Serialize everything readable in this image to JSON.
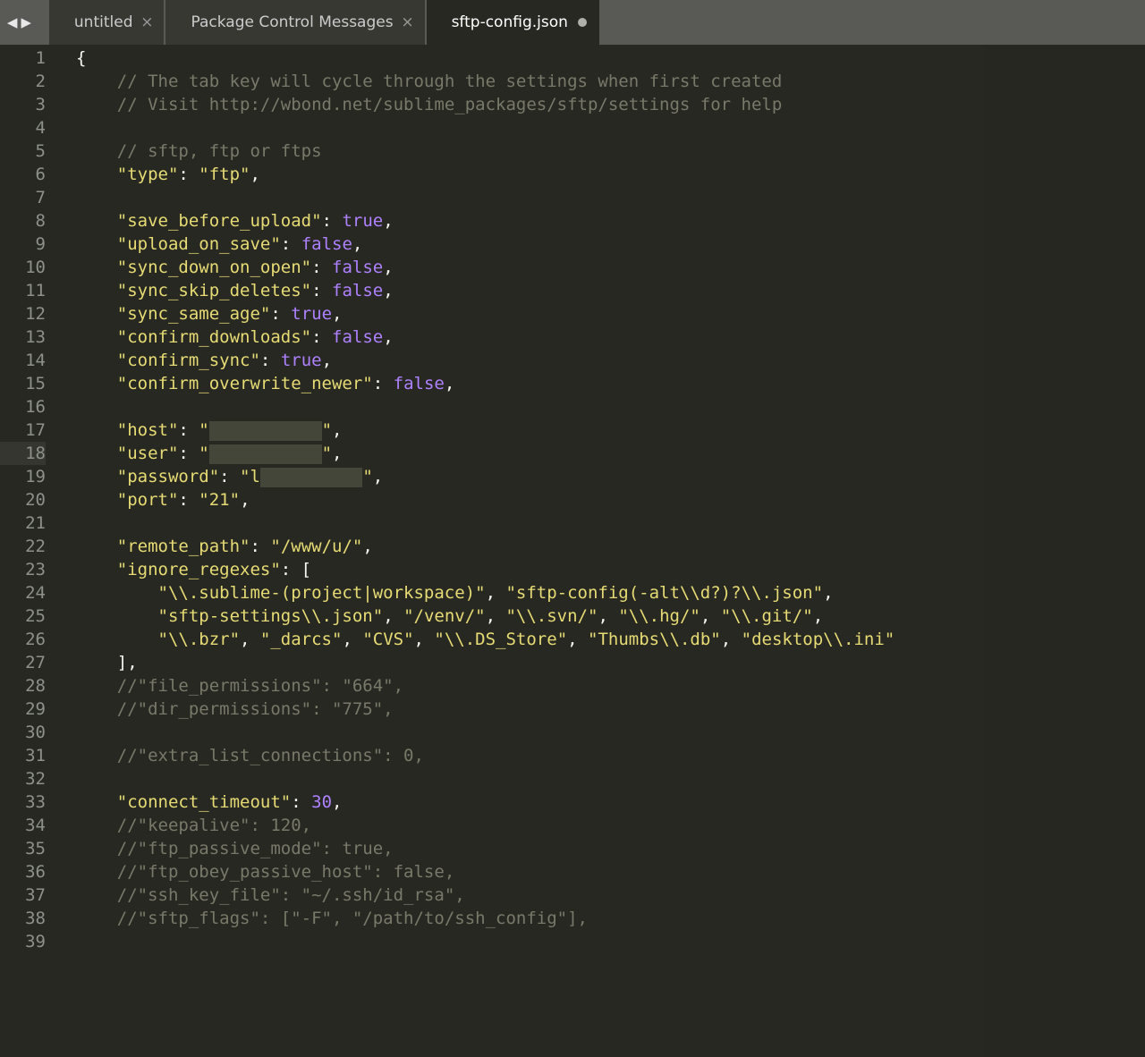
{
  "tabs": [
    {
      "label": "untitled",
      "dirty": false
    },
    {
      "label": "Package Control Messages",
      "dirty": false
    },
    {
      "label": "sftp-config.json",
      "dirty": true
    }
  ],
  "active_tab_index": 2,
  "code_lines": [
    {
      "num": 1,
      "modified": false,
      "segments": [
        {
          "cls": "brace",
          "text": "{"
        }
      ]
    },
    {
      "num": 2,
      "modified": false,
      "segments": [
        {
          "cls": "",
          "text": "    "
        },
        {
          "cls": "comment",
          "text": "// The tab key will cycle through the settings when first created"
        }
      ]
    },
    {
      "num": 3,
      "modified": false,
      "segments": [
        {
          "cls": "",
          "text": "    "
        },
        {
          "cls": "comment",
          "text": "// Visit http://wbond.net/sublime_packages/sftp/settings for help"
        }
      ]
    },
    {
      "num": 4,
      "modified": false,
      "segments": []
    },
    {
      "num": 5,
      "modified": false,
      "segments": [
        {
          "cls": "",
          "text": "    "
        },
        {
          "cls": "comment",
          "text": "// sftp, ftp or ftps"
        }
      ]
    },
    {
      "num": 6,
      "modified": true,
      "segments": [
        {
          "cls": "",
          "text": "    "
        },
        {
          "cls": "key",
          "text": "\"type\""
        },
        {
          "cls": "punct",
          "text": ": "
        },
        {
          "cls": "string",
          "text": "\"ftp\""
        },
        {
          "cls": "punct",
          "text": ","
        }
      ]
    },
    {
      "num": 7,
      "modified": false,
      "segments": []
    },
    {
      "num": 8,
      "modified": false,
      "segments": [
        {
          "cls": "",
          "text": "    "
        },
        {
          "cls": "key",
          "text": "\"save_before_upload\""
        },
        {
          "cls": "punct",
          "text": ": "
        },
        {
          "cls": "bool",
          "text": "true"
        },
        {
          "cls": "punct",
          "text": ","
        }
      ]
    },
    {
      "num": 9,
      "modified": false,
      "segments": [
        {
          "cls": "",
          "text": "    "
        },
        {
          "cls": "key",
          "text": "\"upload_on_save\""
        },
        {
          "cls": "punct",
          "text": ": "
        },
        {
          "cls": "bool",
          "text": "false"
        },
        {
          "cls": "punct",
          "text": ","
        }
      ]
    },
    {
      "num": 10,
      "modified": false,
      "segments": [
        {
          "cls": "",
          "text": "    "
        },
        {
          "cls": "key",
          "text": "\"sync_down_on_open\""
        },
        {
          "cls": "punct",
          "text": ": "
        },
        {
          "cls": "bool",
          "text": "false"
        },
        {
          "cls": "punct",
          "text": ","
        }
      ]
    },
    {
      "num": 11,
      "modified": false,
      "segments": [
        {
          "cls": "",
          "text": "    "
        },
        {
          "cls": "key",
          "text": "\"sync_skip_deletes\""
        },
        {
          "cls": "punct",
          "text": ": "
        },
        {
          "cls": "bool",
          "text": "false"
        },
        {
          "cls": "punct",
          "text": ","
        }
      ]
    },
    {
      "num": 12,
      "modified": false,
      "segments": [
        {
          "cls": "",
          "text": "    "
        },
        {
          "cls": "key",
          "text": "\"sync_same_age\""
        },
        {
          "cls": "punct",
          "text": ": "
        },
        {
          "cls": "bool",
          "text": "true"
        },
        {
          "cls": "punct",
          "text": ","
        }
      ]
    },
    {
      "num": 13,
      "modified": false,
      "segments": [
        {
          "cls": "",
          "text": "    "
        },
        {
          "cls": "key",
          "text": "\"confirm_downloads\""
        },
        {
          "cls": "punct",
          "text": ": "
        },
        {
          "cls": "bool",
          "text": "false"
        },
        {
          "cls": "punct",
          "text": ","
        }
      ]
    },
    {
      "num": 14,
      "modified": false,
      "segments": [
        {
          "cls": "",
          "text": "    "
        },
        {
          "cls": "key",
          "text": "\"confirm_sync\""
        },
        {
          "cls": "punct",
          "text": ": "
        },
        {
          "cls": "bool",
          "text": "true"
        },
        {
          "cls": "punct",
          "text": ","
        }
      ]
    },
    {
      "num": 15,
      "modified": false,
      "segments": [
        {
          "cls": "",
          "text": "    "
        },
        {
          "cls": "key",
          "text": "\"confirm_overwrite_newer\""
        },
        {
          "cls": "punct",
          "text": ": "
        },
        {
          "cls": "bool",
          "text": "false"
        },
        {
          "cls": "punct",
          "text": ","
        }
      ]
    },
    {
      "num": 16,
      "modified": false,
      "segments": []
    },
    {
      "num": 17,
      "modified": true,
      "segments": [
        {
          "cls": "",
          "text": "    "
        },
        {
          "cls": "key",
          "text": "\"host\""
        },
        {
          "cls": "punct",
          "text": ": "
        },
        {
          "cls": "string",
          "text": "\""
        },
        {
          "cls": "redact",
          "text": "xxxxxxxxxxx"
        },
        {
          "cls": "string",
          "text": "\""
        },
        {
          "cls": "punct",
          "text": ","
        }
      ]
    },
    {
      "num": 18,
      "modified": true,
      "cursor": true,
      "segments": [
        {
          "cls": "",
          "text": "    "
        },
        {
          "cls": "key",
          "text": "\"user\""
        },
        {
          "cls": "punct",
          "text": ": "
        },
        {
          "cls": "string",
          "text": "\""
        },
        {
          "cls": "redact",
          "text": "xxxxxxxxxxx"
        },
        {
          "cls": "string",
          "text": "\""
        },
        {
          "cls": "punct",
          "text": ","
        }
      ]
    },
    {
      "num": 19,
      "modified": true,
      "segments": [
        {
          "cls": "",
          "text": "    "
        },
        {
          "cls": "key",
          "text": "\"password\""
        },
        {
          "cls": "punct",
          "text": ": "
        },
        {
          "cls": "string",
          "text": "\"l"
        },
        {
          "cls": "redact",
          "text": "xxxxxxxxxx"
        },
        {
          "cls": "string",
          "text": "\""
        },
        {
          "cls": "punct",
          "text": ","
        }
      ]
    },
    {
      "num": 20,
      "modified": true,
      "segments": [
        {
          "cls": "",
          "text": "    "
        },
        {
          "cls": "key",
          "text": "\"port\""
        },
        {
          "cls": "punct",
          "text": ": "
        },
        {
          "cls": "string",
          "text": "\"21\""
        },
        {
          "cls": "punct",
          "text": ","
        }
      ]
    },
    {
      "num": 21,
      "modified": false,
      "segments": []
    },
    {
      "num": 22,
      "modified": true,
      "segments": [
        {
          "cls": "",
          "text": "    "
        },
        {
          "cls": "key",
          "text": "\"remote_path\""
        },
        {
          "cls": "punct",
          "text": ": "
        },
        {
          "cls": "string",
          "text": "\"/www/u/\""
        },
        {
          "cls": "punct",
          "text": ","
        }
      ]
    },
    {
      "num": 23,
      "modified": false,
      "segments": [
        {
          "cls": "",
          "text": "    "
        },
        {
          "cls": "key",
          "text": "\"ignore_regexes\""
        },
        {
          "cls": "punct",
          "text": ": ["
        }
      ]
    },
    {
      "num": 24,
      "modified": false,
      "segments": [
        {
          "cls": "",
          "text": "        "
        },
        {
          "cls": "string",
          "text": "\"\\\\.sublime-(project|workspace)\""
        },
        {
          "cls": "punct",
          "text": ", "
        },
        {
          "cls": "string",
          "text": "\"sftp-config(-alt\\\\d?)?\\\\.json\""
        },
        {
          "cls": "punct",
          "text": ","
        }
      ]
    },
    {
      "num": 25,
      "modified": false,
      "segments": [
        {
          "cls": "",
          "text": "        "
        },
        {
          "cls": "string",
          "text": "\"sftp-settings\\\\.json\""
        },
        {
          "cls": "punct",
          "text": ", "
        },
        {
          "cls": "string",
          "text": "\"/venv/\""
        },
        {
          "cls": "punct",
          "text": ", "
        },
        {
          "cls": "string",
          "text": "\"\\\\.svn/\""
        },
        {
          "cls": "punct",
          "text": ", "
        },
        {
          "cls": "string",
          "text": "\"\\\\.hg/\""
        },
        {
          "cls": "punct",
          "text": ", "
        },
        {
          "cls": "string",
          "text": "\"\\\\.git/\""
        },
        {
          "cls": "punct",
          "text": ","
        }
      ]
    },
    {
      "num": 26,
      "modified": false,
      "segments": [
        {
          "cls": "",
          "text": "        "
        },
        {
          "cls": "string",
          "text": "\"\\\\.bzr\""
        },
        {
          "cls": "punct",
          "text": ", "
        },
        {
          "cls": "string",
          "text": "\"_darcs\""
        },
        {
          "cls": "punct",
          "text": ", "
        },
        {
          "cls": "string",
          "text": "\"CVS\""
        },
        {
          "cls": "punct",
          "text": ", "
        },
        {
          "cls": "string",
          "text": "\"\\\\.DS_Store\""
        },
        {
          "cls": "punct",
          "text": ", "
        },
        {
          "cls": "string",
          "text": "\"Thumbs\\\\.db\""
        },
        {
          "cls": "punct",
          "text": ", "
        },
        {
          "cls": "string",
          "text": "\"desktop\\\\.ini\""
        }
      ]
    },
    {
      "num": 27,
      "modified": false,
      "segments": [
        {
          "cls": "",
          "text": "    "
        },
        {
          "cls": "punct",
          "text": "],"
        }
      ]
    },
    {
      "num": 28,
      "modified": false,
      "segments": [
        {
          "cls": "",
          "text": "    "
        },
        {
          "cls": "comment",
          "text": "//\"file_permissions\": \"664\","
        }
      ]
    },
    {
      "num": 29,
      "modified": false,
      "segments": [
        {
          "cls": "",
          "text": "    "
        },
        {
          "cls": "comment",
          "text": "//\"dir_permissions\": \"775\","
        }
      ]
    },
    {
      "num": 30,
      "modified": false,
      "segments": []
    },
    {
      "num": 31,
      "modified": false,
      "segments": [
        {
          "cls": "",
          "text": "    "
        },
        {
          "cls": "comment",
          "text": "//\"extra_list_connections\": 0,"
        }
      ]
    },
    {
      "num": 32,
      "modified": false,
      "segments": []
    },
    {
      "num": 33,
      "modified": false,
      "segments": [
        {
          "cls": "",
          "text": "    "
        },
        {
          "cls": "key",
          "text": "\"connect_timeout\""
        },
        {
          "cls": "punct",
          "text": ": "
        },
        {
          "cls": "num",
          "text": "30"
        },
        {
          "cls": "punct",
          "text": ","
        }
      ]
    },
    {
      "num": 34,
      "modified": false,
      "segments": [
        {
          "cls": "",
          "text": "    "
        },
        {
          "cls": "comment",
          "text": "//\"keepalive\": 120,"
        }
      ]
    },
    {
      "num": 35,
      "modified": false,
      "segments": [
        {
          "cls": "",
          "text": "    "
        },
        {
          "cls": "comment",
          "text": "//\"ftp_passive_mode\": true,"
        }
      ]
    },
    {
      "num": 36,
      "modified": false,
      "segments": [
        {
          "cls": "",
          "text": "    "
        },
        {
          "cls": "comment",
          "text": "//\"ftp_obey_passive_host\": false,"
        }
      ]
    },
    {
      "num": 37,
      "modified": false,
      "segments": [
        {
          "cls": "",
          "text": "    "
        },
        {
          "cls": "comment",
          "text": "//\"ssh_key_file\": \"~/.ssh/id_rsa\","
        }
      ]
    },
    {
      "num": 38,
      "modified": false,
      "segments": [
        {
          "cls": "",
          "text": "    "
        },
        {
          "cls": "comment",
          "text": "//\"sftp_flags\": [\"-F\", \"/path/to/ssh_config\"],"
        }
      ]
    },
    {
      "num": 39,
      "modified": false,
      "segments": []
    }
  ]
}
